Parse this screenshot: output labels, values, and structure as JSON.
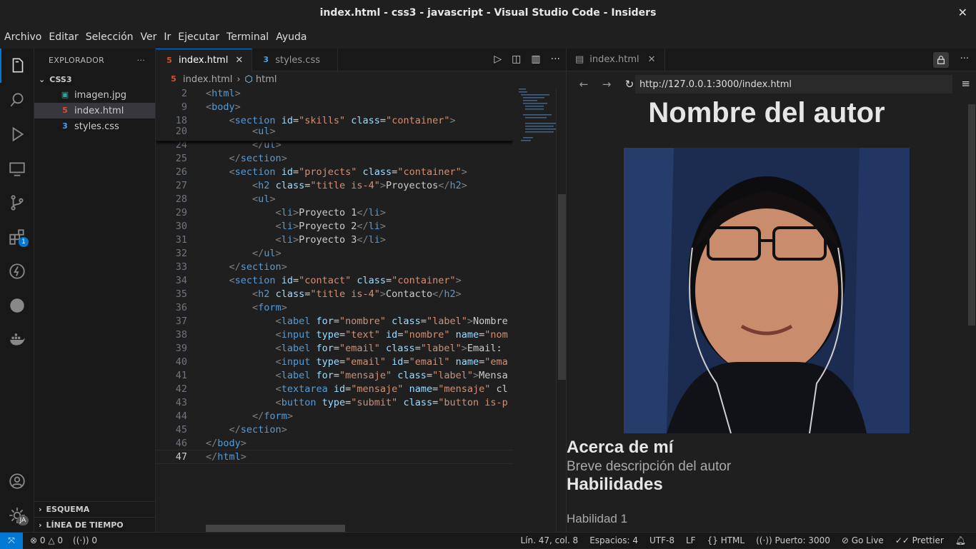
{
  "window": {
    "title": "index.html - css3 - javascript - Visual Studio Code - Insiders"
  },
  "menu": [
    "Archivo",
    "Editar",
    "Selección",
    "Ver",
    "Ir",
    "Ejecutar",
    "Terminal",
    "Ayuda"
  ],
  "activity": {
    "extensions_badge": "1",
    "account_initials": "JA"
  },
  "sidebar": {
    "title": "EXPLORADOR",
    "folder": "CSS3",
    "files": [
      {
        "name": "imagen.jpg"
      },
      {
        "name": "index.html"
      },
      {
        "name": "styles.css"
      }
    ],
    "outline": "ESQUEMA",
    "timeline": "LÍNEA DE TIEMPO"
  },
  "editor": {
    "tabs": [
      {
        "label": "index.html"
      },
      {
        "label": "styles.css"
      }
    ],
    "breadcrumb": [
      "index.html",
      "html"
    ],
    "lines": [
      {
        "n": "2",
        "t": "<html>"
      },
      {
        "n": "9",
        "t": "<body>"
      },
      {
        "n": "18",
        "t": "    <section id=\"skills\" class=\"container\">"
      },
      {
        "n": "20",
        "t": "        <ul>"
      },
      {
        "n": "24",
        "t": "        </ul>"
      },
      {
        "n": "25",
        "t": "    </section>"
      },
      {
        "n": "26",
        "t": "    <section id=\"projects\" class=\"container\">"
      },
      {
        "n": "27",
        "t": "        <h2 class=\"title is-4\">Proyectos</h2>"
      },
      {
        "n": "28",
        "t": "        <ul>"
      },
      {
        "n": "29",
        "t": "            <li>Proyecto 1</li>"
      },
      {
        "n": "30",
        "t": "            <li>Proyecto 2</li>"
      },
      {
        "n": "31",
        "t": "            <li>Proyecto 3</li>"
      },
      {
        "n": "32",
        "t": "        </ul>"
      },
      {
        "n": "33",
        "t": "    </section>"
      },
      {
        "n": "34",
        "t": "    <section id=\"contact\" class=\"container\">"
      },
      {
        "n": "35",
        "t": "        <h2 class=\"title is-4\">Contacto</h2>"
      },
      {
        "n": "36",
        "t": "        <form>"
      },
      {
        "n": "37",
        "t": "            <label for=\"nombre\" class=\"label\">Nombre"
      },
      {
        "n": "38",
        "t": "            <input type=\"text\" id=\"nombre\" name=\"nom"
      },
      {
        "n": "39",
        "t": "            <label for=\"email\" class=\"label\">Email:"
      },
      {
        "n": "40",
        "t": "            <input type=\"email\" id=\"email\" name=\"ema"
      },
      {
        "n": "41",
        "t": "            <label for=\"mensaje\" class=\"label\">Mensa"
      },
      {
        "n": "42",
        "t": "            <textarea id=\"mensaje\" name=\"mensaje\" cl"
      },
      {
        "n": "43",
        "t": "            <button type=\"submit\" class=\"button is-p"
      },
      {
        "n": "44",
        "t": "        </form>"
      },
      {
        "n": "45",
        "t": "    </section>"
      },
      {
        "n": "46",
        "t": "</body>"
      },
      {
        "n": "47",
        "t": "</html>"
      }
    ]
  },
  "preview": {
    "tab": "index.html",
    "url": "http://127.0.0.1:3000/index.html",
    "heading": "Nombre del autor",
    "about_title": "Acerca de mí",
    "about_text": "Breve descripción del autor",
    "skills_title": "Habilidades",
    "skill_1": "Habilidad 1"
  },
  "status": {
    "errors": "0",
    "warnings": "0",
    "ports": "0",
    "position": "Lín. 47, col. 8",
    "spaces": "Espacios: 4",
    "encoding": "UTF-8",
    "eol": "LF",
    "language": "HTML",
    "port": "Puerto: 3000",
    "golive": "Go Live",
    "prettier": "Prettier"
  }
}
